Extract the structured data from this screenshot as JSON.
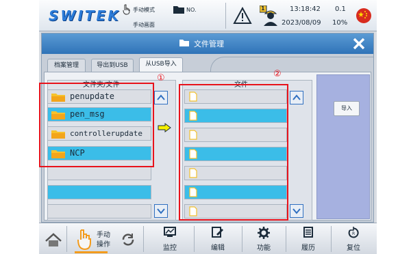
{
  "topbar": {
    "logo": "SWITEK",
    "mode": "手动模式",
    "mode_sub": "手动画面",
    "no_label": "NO.",
    "time": "13:18:42",
    "date": "2023/08/09",
    "value": "0.1",
    "percent": "10%",
    "worker_badge": "1"
  },
  "dialog": {
    "title": "文件管理",
    "tabs": [
      {
        "label": "档案管理",
        "active": false
      },
      {
        "label": "导出到USB",
        "active": false
      },
      {
        "label": "从USB导入",
        "active": true
      }
    ],
    "left_header": "文件夹/文件",
    "right_header": "文件",
    "folders": [
      "penupdate",
      "pen_msg",
      "controllerupdate",
      "NCP"
    ],
    "import_button": "导入",
    "annotations": {
      "left": "①",
      "right": "②"
    }
  },
  "bottombar": {
    "manual_line1": "手动",
    "manual_line2": "操作",
    "items": [
      "监控",
      "编辑",
      "功能",
      "履历",
      "复位"
    ]
  },
  "colors": {
    "accent_blue": "#3bbde8",
    "title_blue": "#2f73b8",
    "annotation_red": "#e8121b",
    "folder_yellow": "#f7c22b"
  }
}
